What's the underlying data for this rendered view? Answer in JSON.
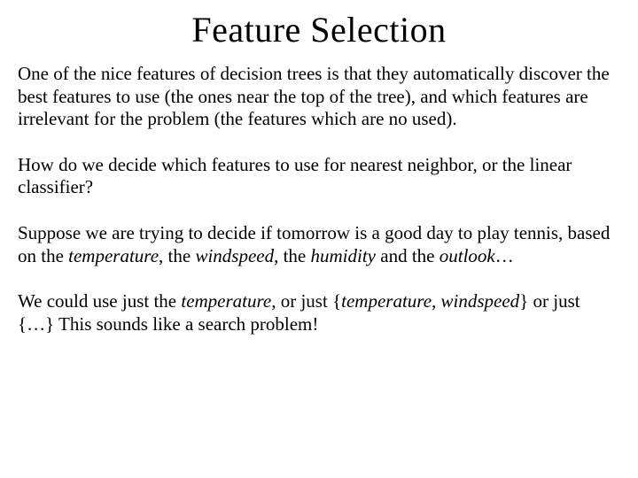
{
  "title": "Feature Selection",
  "p1_a": "One of the nice features of decision trees is that they automatically discover the best features to use (the ones near the top of the tree), and which features are irrelevant for the problem (the features which are no used).",
  "p2_a": "How do we decide which features to use for nearest neighbor, or the linear classifier?",
  "p3_a": "Suppose we are trying to decide if tomorrow is a good day to play tennis, based on the ",
  "p3_temp": "temperature",
  "p3_b": ", the ",
  "p3_wind": "windspeed",
  "p3_c": ", the ",
  "p3_hum": "humidity",
  "p3_d": " and the ",
  "p3_out": "outlook",
  "p3_e": "…",
  "p4_a": "We could use just the ",
  "p4_temp": "temperature,",
  "p4_b": " or just {",
  "p4_set": "temperature, windspeed",
  "p4_c": "} or just {…}   This sounds like a search problem!"
}
